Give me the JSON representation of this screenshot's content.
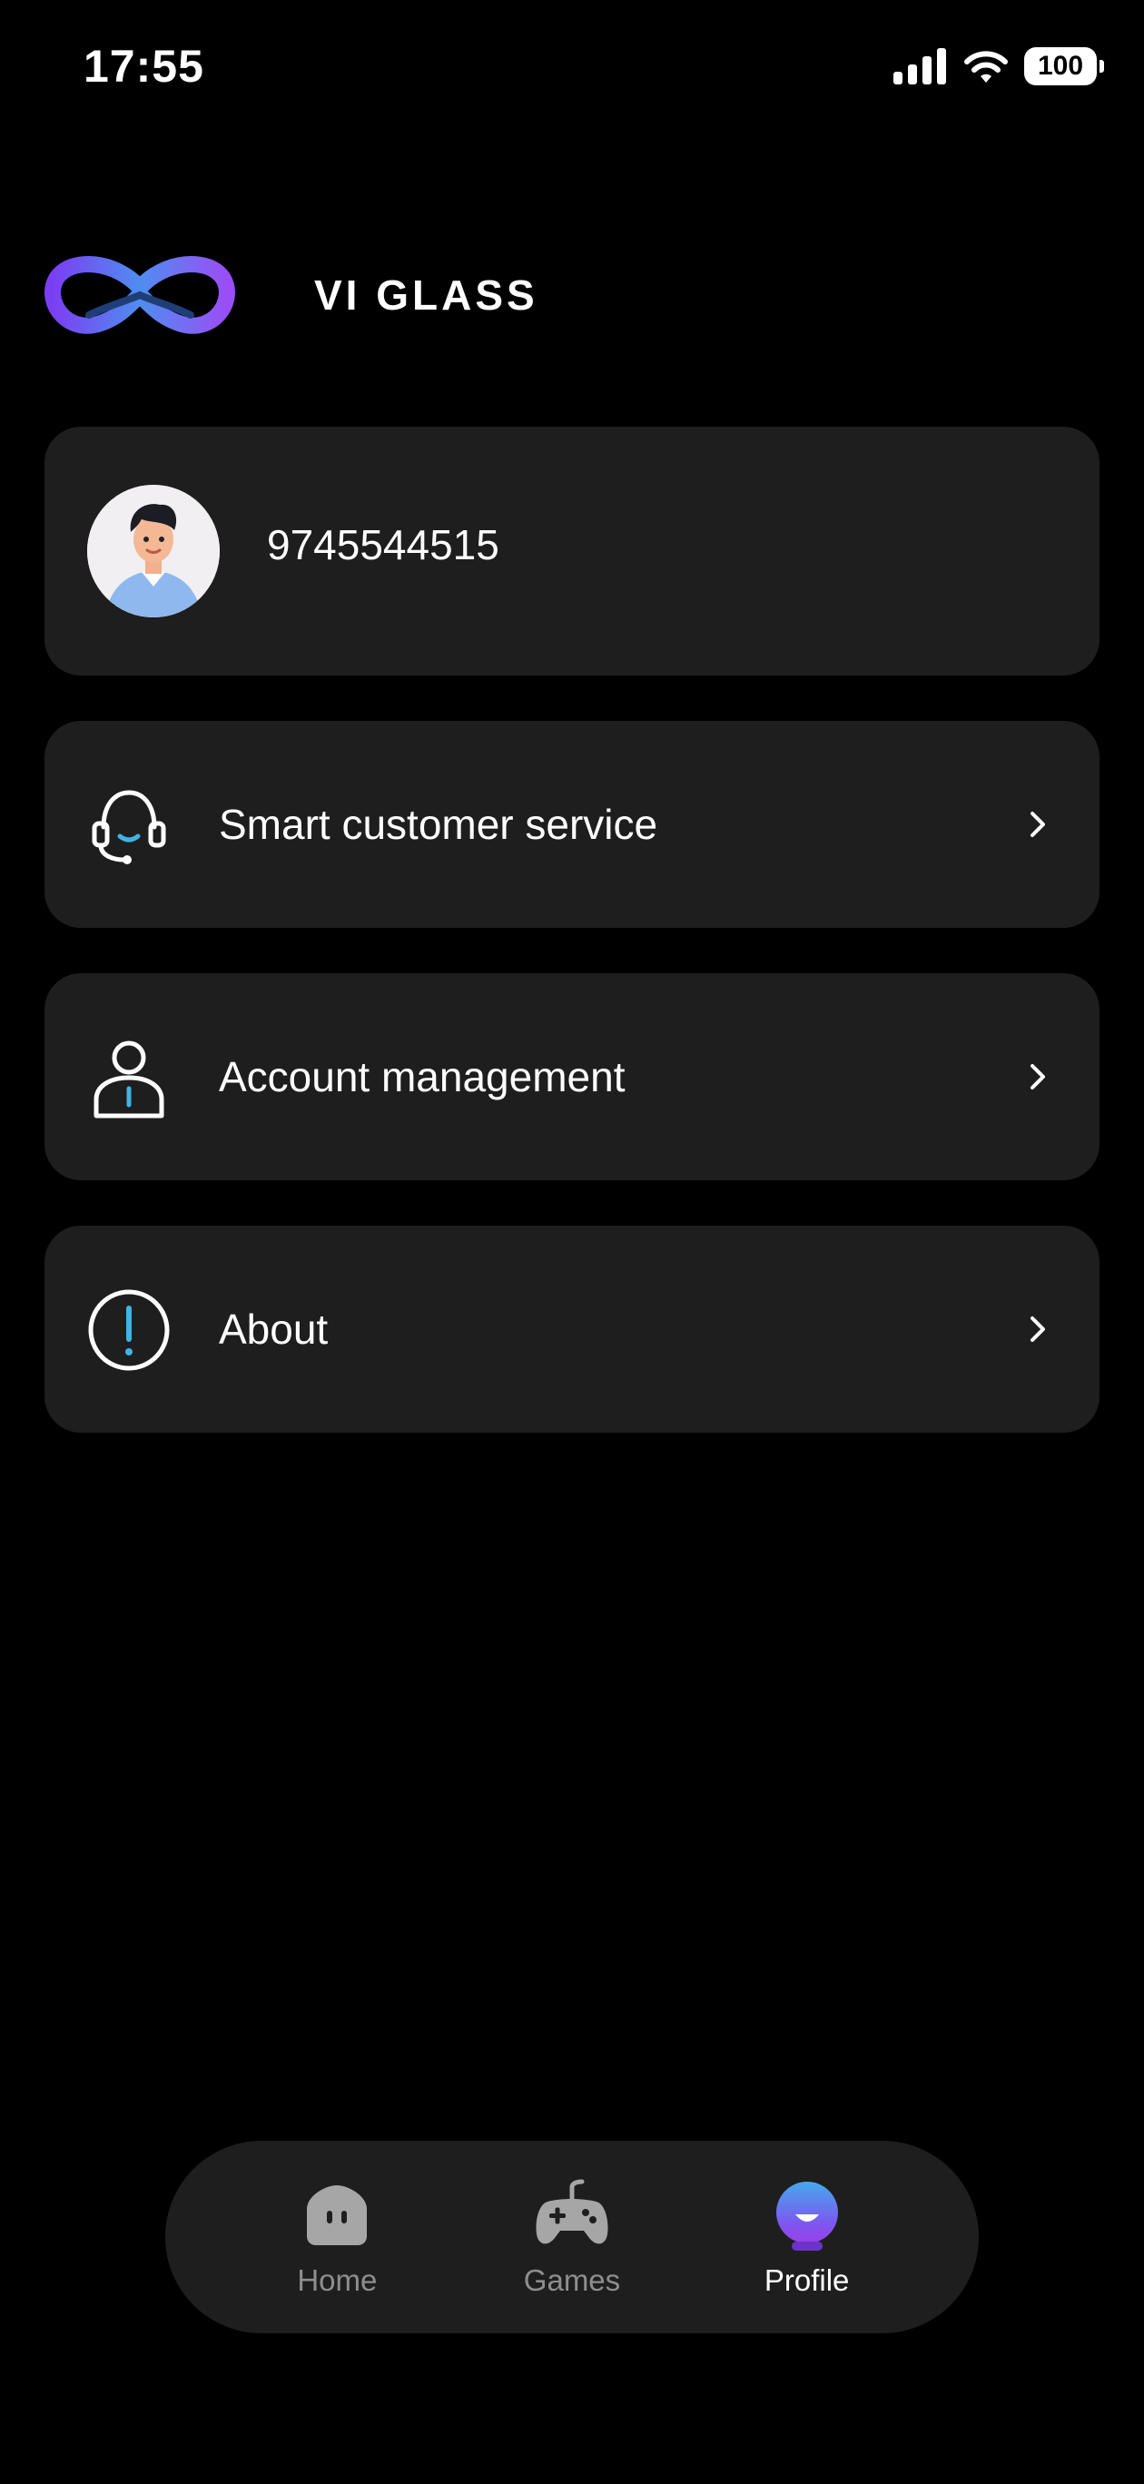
{
  "status": {
    "time": "17:55",
    "battery": "100"
  },
  "brand": {
    "name": "VI GLASS"
  },
  "profile": {
    "phone": "9745544515"
  },
  "menu": [
    {
      "label": "Smart customer service",
      "icon": "headset-icon"
    },
    {
      "label": "Account management",
      "icon": "user-icon"
    },
    {
      "label": "About",
      "icon": "info-icon"
    }
  ],
  "tabs": [
    {
      "label": "Home",
      "icon": "home-robot-icon",
      "active": false
    },
    {
      "label": "Games",
      "icon": "gamepad-icon",
      "active": false
    },
    {
      "label": "Profile",
      "icon": "profile-bubble-icon",
      "active": true
    }
  ],
  "colors": {
    "background": "#000000",
    "card": "#1e1e1e",
    "accent_blue": "#3fb3e6",
    "accent_purple": "#8b4cf5",
    "tab_inactive": "#8e8e8e"
  }
}
